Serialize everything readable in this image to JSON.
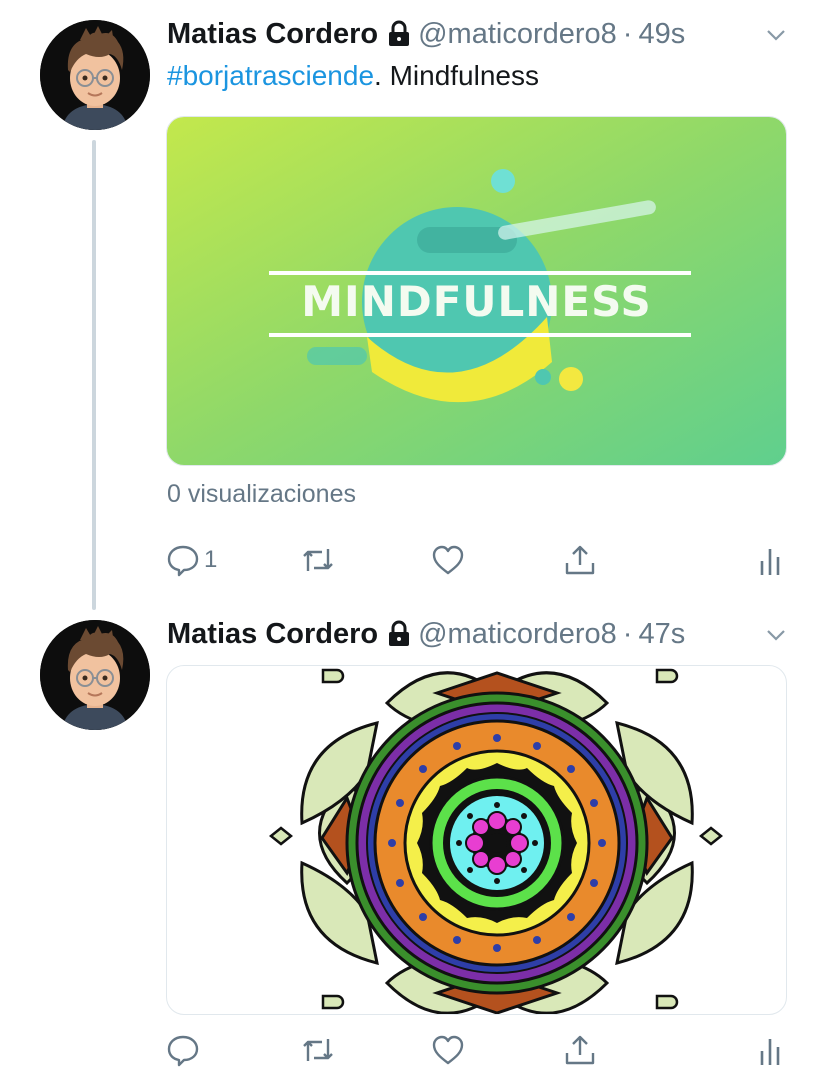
{
  "tweets": [
    {
      "author_name": "Matias Cordero",
      "author_handle": "@maticordero8",
      "separator": "·",
      "time": "49s",
      "hashtag": "#borjatrasciende",
      "text": ". Mindfulness",
      "media_title": "MINDFULNESS",
      "views": "0 visualizaciones",
      "reply_count": "1"
    },
    {
      "author_name": "Matias Cordero",
      "author_handle": "@maticordero8",
      "separator": "·",
      "time": "47s"
    }
  ],
  "colors": {
    "link": "#1b95e0",
    "secondary": "#657786",
    "thread_line": "#ccd6dd"
  },
  "icons": [
    "lock-icon",
    "chevron-down-icon",
    "reply-icon",
    "retweet-icon",
    "like-icon",
    "share-icon",
    "analytics-icon"
  ]
}
